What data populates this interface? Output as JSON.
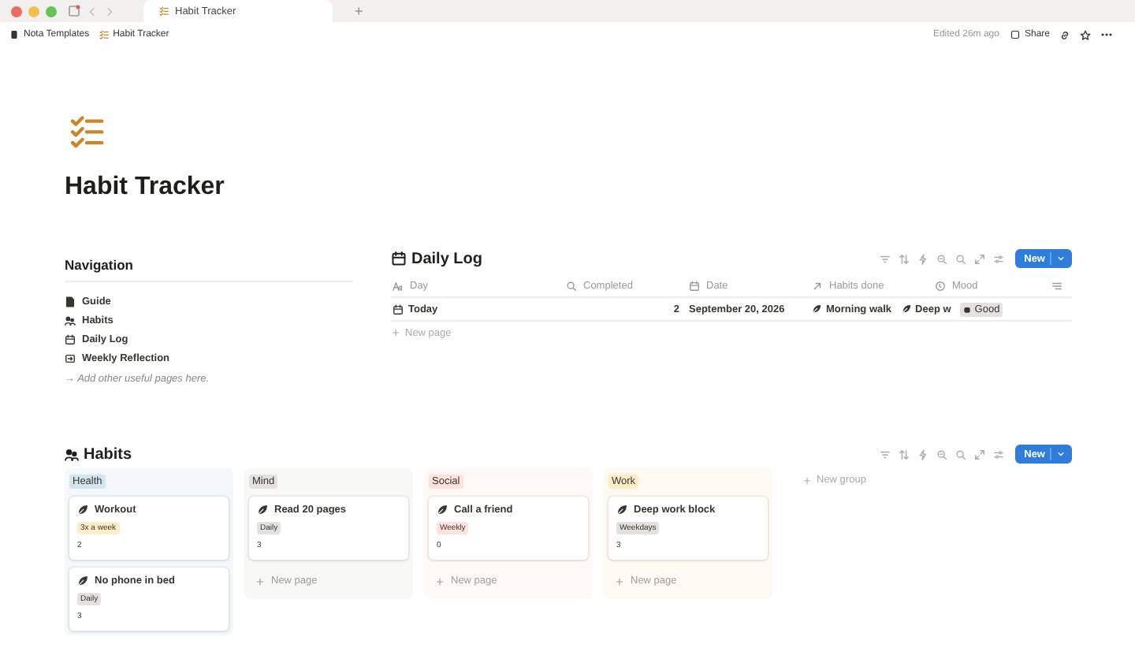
{
  "browser": {
    "tabs": [
      {
        "title": "Habit Tracker",
        "selected": true
      }
    ],
    "new_tab": "+"
  },
  "breadcrumb": [
    "Nota Templates",
    "Habit Tracker"
  ],
  "header": {
    "edited": "Edited 26m ago",
    "share": "Share"
  },
  "page": {
    "title": "Habit Tracker"
  },
  "navigation": {
    "title": "Navigation",
    "items": [
      "Guide",
      "Habits",
      "Daily Log",
      "Weekly Reflection"
    ],
    "hint": "→ Add other useful pages here."
  },
  "daily_log": {
    "title": "Daily Log",
    "new_button": "New",
    "columns": [
      "Day",
      "Completed",
      "Date",
      "Habits done",
      "Mood"
    ],
    "rows": [
      {
        "day": "Today",
        "completed": "2",
        "date": "September 20, 2026",
        "habits": [
          "Morning walk",
          "Deep w"
        ],
        "mood": "Good"
      }
    ],
    "new_page": "New page"
  },
  "habits": {
    "title": "Habits",
    "new_button": "New",
    "new_group": "New group",
    "groups": [
      {
        "name": "Health",
        "color": "#d3e5ef",
        "cards": [
          {
            "title": "Workout",
            "frequency": {
              "label": "3x a week",
              "color": "#fdecc8"
            },
            "count": "2"
          },
          {
            "title": "No phone in bed",
            "frequency": {
              "label": "Daily",
              "color": "#e3e2e0"
            },
            "count": "3"
          }
        ]
      },
      {
        "name": "Mind",
        "color": "#e3e2e0",
        "cards": [
          {
            "title": "Read 20 pages",
            "frequency": {
              "label": "Daily",
              "color": "#e3e2e0"
            },
            "count": "3"
          }
        ],
        "new_page": "New page"
      },
      {
        "name": "Social",
        "color": "#ffe2dd",
        "cards": [
          {
            "title": "Call a friend",
            "frequency": {
              "label": "Weekly",
              "color": "#ffe2dd"
            },
            "count": "0"
          }
        ],
        "new_page": "New page"
      },
      {
        "name": "Work",
        "color": "#fdecc8",
        "cards": [
          {
            "title": "Deep work block",
            "frequency": {
              "label": "Weekdays",
              "color": "#e3e2e0"
            },
            "count": "3"
          }
        ],
        "new_page": "New page"
      }
    ]
  }
}
